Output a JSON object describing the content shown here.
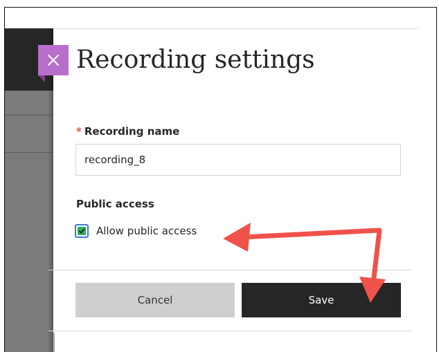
{
  "dialog": {
    "title": "Recording settings",
    "close_icon": "close-icon"
  },
  "form": {
    "recording_name": {
      "required_marker": "*",
      "label": "Recording name",
      "value": "recording_8"
    },
    "public_access": {
      "section_label": "Public access",
      "checkbox_label": "Allow public access",
      "checked": true
    }
  },
  "footer": {
    "cancel_label": "Cancel",
    "save_label": "Save"
  },
  "colors": {
    "close_accent": "#b86fcc",
    "save_button": "#262626",
    "checkbox_fill": "#2fae5a",
    "annotation_arrow": "#f0524a"
  }
}
